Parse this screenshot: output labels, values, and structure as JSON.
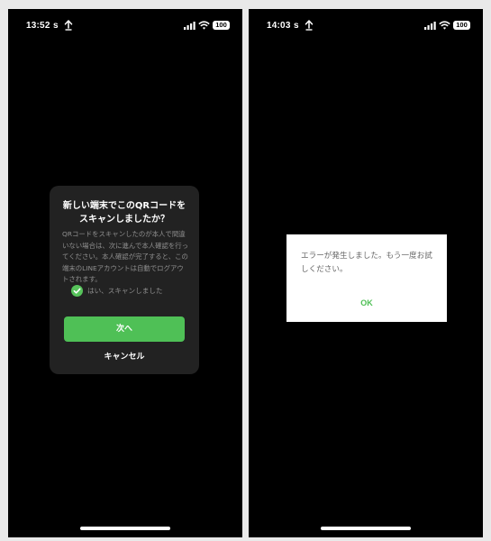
{
  "screens": [
    {
      "status_bar": {
        "time": "13:52",
        "app_indicator": "s",
        "upload_icon": "upload-arrow-icon",
        "battery": "100"
      },
      "dialog": {
        "title": "新しい端末でこのQRコードをスキャンしましたか？",
        "title_line1": "新しい端末でこのQRコードを",
        "title_line2": "スキャンしましたか？",
        "body": "QRコードをスキャンしたのが本人で間違いない場合は、次に進んで本人確認を行ってください。本人確認が完了すると、この端末のLINEアカウントは自動でログアウトされます。",
        "checkbox_label": "はい、スキャンしました",
        "checkbox_checked": true,
        "primary_button": "次へ",
        "secondary_button": "キャンセル"
      }
    },
    {
      "status_bar": {
        "time": "14:03",
        "app_indicator": "s",
        "upload_icon": "upload-arrow-icon",
        "battery": "100"
      },
      "dialog": {
        "message": "エラーが発生しました。もう一度お試しください。",
        "ok_button": "OK"
      }
    }
  ],
  "colors": {
    "accent_green": "#4fc056",
    "dialog_dark": "#222222",
    "background": "#000000"
  }
}
